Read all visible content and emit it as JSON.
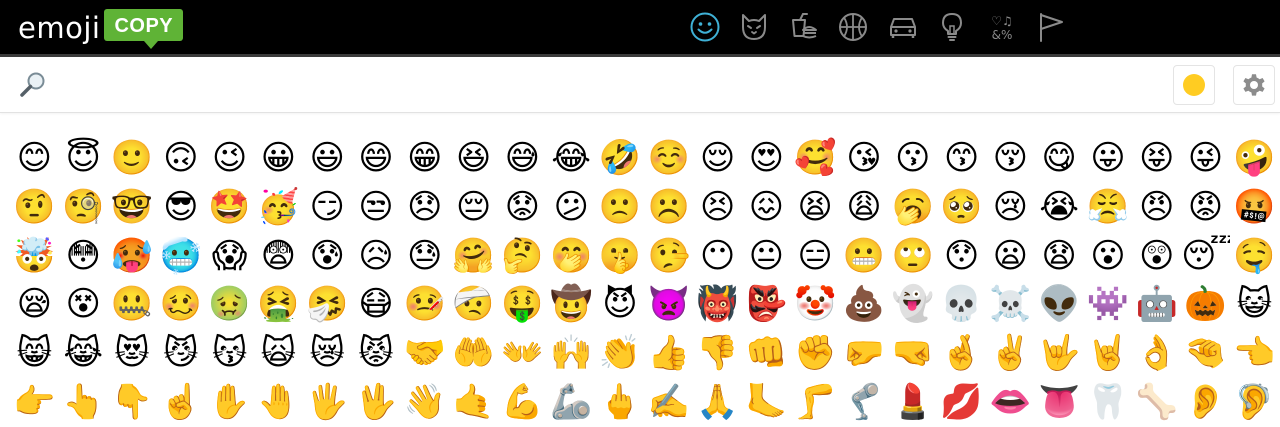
{
  "logo": {
    "text": "emoji",
    "badge": "COPY"
  },
  "categories": [
    {
      "id": "smileys",
      "icon": "smiley-icon",
      "active": true,
      "color": "#3fb1d6"
    },
    {
      "id": "animals",
      "icon": "cat-face-icon",
      "active": false,
      "color": "#8a8a8a"
    },
    {
      "id": "food",
      "icon": "drink-burger-icon",
      "active": false,
      "color": "#8a8a8a"
    },
    {
      "id": "activities",
      "icon": "basketball-icon",
      "active": false,
      "color": "#8a8a8a"
    },
    {
      "id": "travel",
      "icon": "car-icon",
      "active": false,
      "color": "#8a8a8a"
    },
    {
      "id": "objects",
      "icon": "lightbulb-icon",
      "active": false,
      "color": "#8a8a8a"
    },
    {
      "id": "symbols",
      "icon": "symbols-icon",
      "active": false,
      "color": "#8a8a8a"
    },
    {
      "id": "flags",
      "icon": "flag-icon",
      "active": false,
      "color": "#8a8a8a"
    }
  ],
  "symbols_icon_text": {
    "top": "♡♫",
    "bottom": "&%"
  },
  "search": {
    "placeholder": "",
    "value": ""
  },
  "skin_tone": {
    "color": "#ffcc22"
  },
  "emoji_rows": [
    [
      "😊",
      "😇",
      "🙂",
      "🙃",
      "😉",
      "😀",
      "😃",
      "😄",
      "😁",
      "😆",
      "😅",
      "😂",
      "🤣",
      "☺️",
      "😌",
      "😍",
      "🥰",
      "😘",
      "😗",
      "😙",
      "😚",
      "😋",
      "😛",
      "😝",
      "😜",
      "🤪"
    ],
    [
      "🤨",
      "🧐",
      "🤓",
      "😎",
      "🤩",
      "🥳",
      "😏",
      "😒",
      "😞",
      "😔",
      "😟",
      "😕",
      "🙁",
      "☹️",
      "😣",
      "😖",
      "😫",
      "😩",
      "🥱",
      "🥺",
      "😢",
      "😭",
      "😤",
      "😠",
      "😡",
      "🤬"
    ],
    [
      "🤯",
      "😳",
      "🥵",
      "🥶",
      "😱",
      "😨",
      "😰",
      "😥",
      "😓",
      "🤗",
      "🤔",
      "🤭",
      "🤫",
      "🤥",
      "😶",
      "😐",
      "😑",
      "😬",
      "🙄",
      "😯",
      "😦",
      "😧",
      "😮",
      "😲",
      "😴",
      "🤤"
    ],
    [
      "😪",
      "😵",
      "🤐",
      "🥴",
      "🤢",
      "🤮",
      "🤧",
      "😷",
      "🤒",
      "🤕",
      "🤑",
      "🤠",
      "😈",
      "👿",
      "👹",
      "👺",
      "🤡",
      "💩",
      "👻",
      "💀",
      "☠️",
      "👽",
      "👾",
      "🤖",
      "🎃",
      "😺"
    ],
    [
      "😸",
      "😹",
      "😻",
      "😼",
      "😽",
      "🙀",
      "😿",
      "😾",
      "🤝",
      "🤲",
      "👐",
      "🙌",
      "👏",
      "👍",
      "👎",
      "👊",
      "✊",
      "🤛",
      "🤜",
      "🤞",
      "✌️",
      "🤟",
      "🤘",
      "👌",
      "🤏",
      "👈"
    ],
    [
      "👉",
      "👆",
      "👇",
      "☝️",
      "✋",
      "🤚",
      "🖐️",
      "🖖",
      "👋",
      "🤙",
      "💪",
      "🦾",
      "🖕",
      "✍️",
      "🙏",
      "🦶",
      "🦵",
      "🦿",
      "💄",
      "💋",
      "👄",
      "👅",
      "🦷",
      "🦴",
      "👂",
      "🦻"
    ]
  ]
}
